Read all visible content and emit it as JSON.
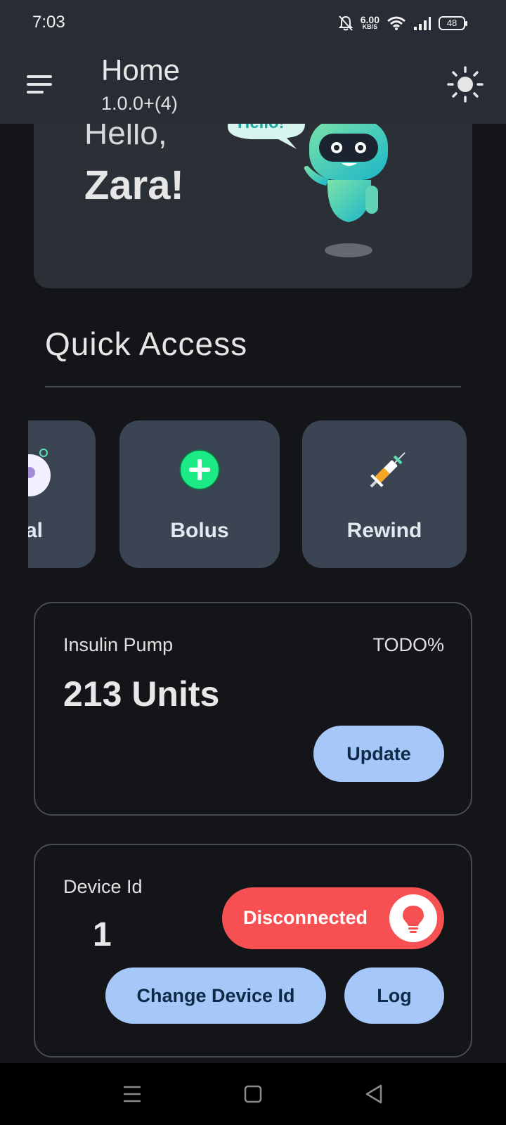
{
  "status_bar": {
    "time": "7:03",
    "net_speed_value": "6.00",
    "net_speed_unit": "KB/S",
    "battery": "48",
    "icons": [
      "mute-icon",
      "wifi-icon",
      "signal-icon",
      "battery-icon"
    ]
  },
  "app_bar": {
    "title": "Home",
    "subtitle": "1.0.0+(4)",
    "menu_icon": "menu-icon",
    "theme_icon": "sun-icon"
  },
  "greeting": {
    "hello": "Hello,",
    "name": "Zara!",
    "bubble_text": "Hello!"
  },
  "quick_access": {
    "title": "Quick Access",
    "tiles": [
      {
        "label": "al",
        "icon": "basal-icon"
      },
      {
        "label": "Bolus",
        "icon": "plus-circle-icon"
      },
      {
        "label": "Rewind",
        "icon": "syringe-icon"
      }
    ]
  },
  "pump_card": {
    "label": "Insulin Pump",
    "percent": "TODO%",
    "value": "213 Units",
    "update_label": "Update"
  },
  "device_card": {
    "label": "Device Id",
    "id": "1",
    "status": "Disconnected",
    "status_color": "#f65052",
    "change_label": "Change Device Id",
    "log_label": "Log"
  },
  "colors": {
    "background": "#131519",
    "bar": "#282c34",
    "accent_button": "#a5c8f8",
    "tile": "#3a4452",
    "plus_green": "#1de985"
  },
  "nav_bar": {
    "icons": [
      "recents-icon",
      "home-icon",
      "back-icon"
    ]
  }
}
